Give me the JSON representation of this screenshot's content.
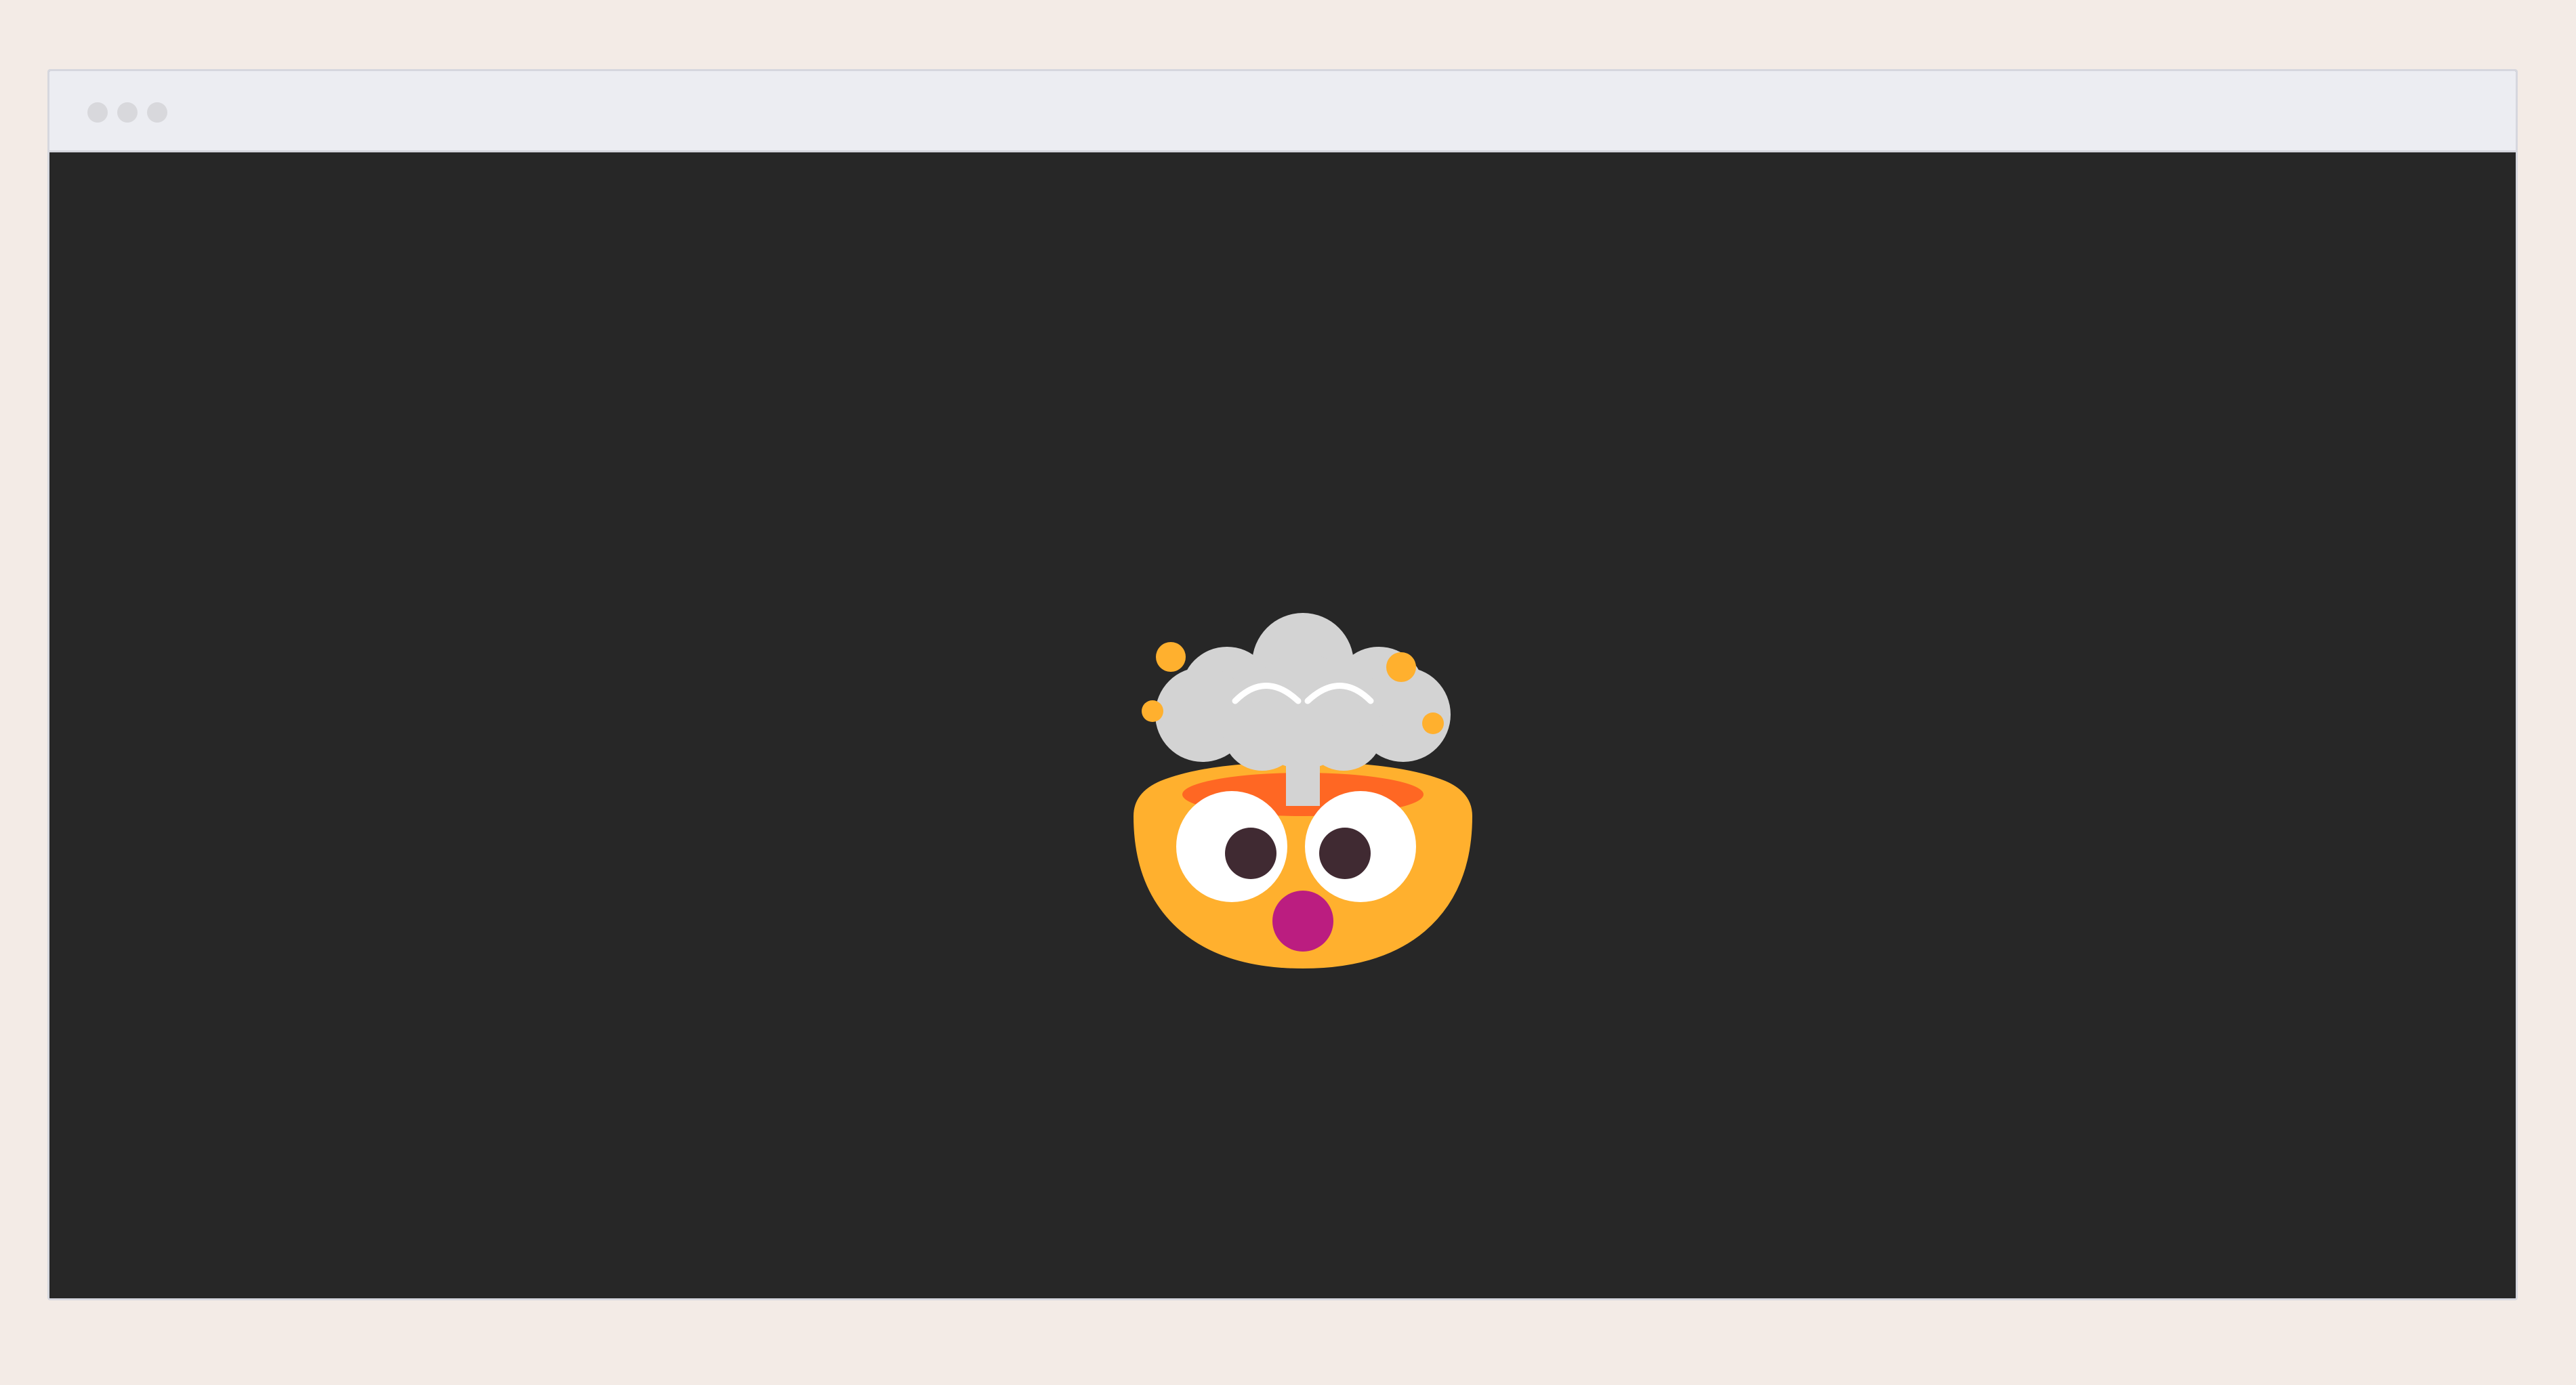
{
  "window": {
    "controls": [
      "window-dot",
      "window-dot",
      "window-dot"
    ]
  },
  "content": {
    "illustration": "exploding-head-emoji",
    "colors": {
      "page_background": "#f3ebe6",
      "titlebar": "#ecedf2",
      "viewport_background": "#272727",
      "face": "#ffb02e",
      "brain_opening": "#ff6723",
      "cloud": "#d3d3d3",
      "eye_white": "#ffffff",
      "pupil": "#402a32",
      "mouth": "#bb1d80"
    }
  }
}
